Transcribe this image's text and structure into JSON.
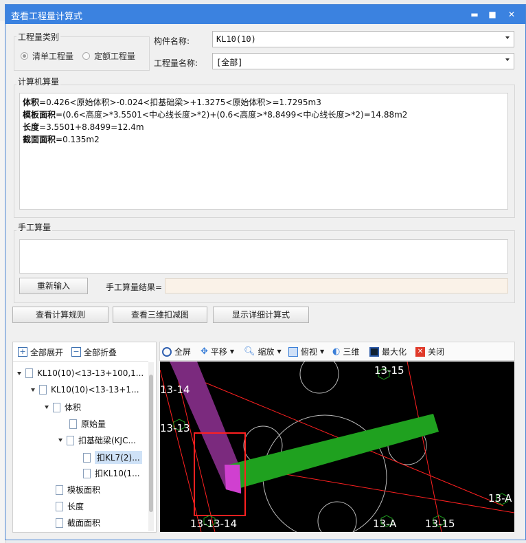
{
  "window": {
    "title": "查看工程量计算式"
  },
  "qty_category": {
    "group_label": "工程量类别",
    "options": [
      {
        "label": "清单工程量",
        "selected": true
      },
      {
        "label": "定额工程量",
        "selected": false
      }
    ]
  },
  "component": {
    "label": "构件名称:",
    "value": "KL10(10)"
  },
  "qty_name": {
    "label": "工程量名称:",
    "value": "[全部]"
  },
  "computer_calc": {
    "group_label": "计算机算量",
    "lines": [
      {
        "key": "体积",
        "expr": "=0.426<原始体积>-0.024<扣基础梁>+1.3275<原始体积>=1.7295m3"
      },
      {
        "key": "模板面积",
        "expr": "=(0.6<高度>*3.5501<中心线长度>*2)+(0.6<高度>*8.8499<中心线长度>*2)=14.88m2"
      },
      {
        "key": "长度",
        "expr": "=3.5501+8.8499=12.4m"
      },
      {
        "key": "截面面积",
        "expr": "=0.135m2"
      }
    ]
  },
  "manual_calc": {
    "group_label": "手工算量",
    "reinput_button": "重新输入",
    "result_label": "手工算量结果="
  },
  "actions": {
    "rules_button": "查看计算规则",
    "deduct3d_button": "查看三维扣减图",
    "detail_button": "显示详细计算式"
  },
  "tree": {
    "expand_all": "全部展开",
    "collapse_all": "全部折叠",
    "items": [
      {
        "label": "KL10(10)<13-13+100,1..."
      },
      {
        "label": "KL10(10)<13-13+1..."
      },
      {
        "label": "体积"
      },
      {
        "label": "原始量"
      },
      {
        "label": "扣基础梁(KJC..."
      },
      {
        "label": "扣KL7(2)..."
      },
      {
        "label": "扣KL10(1..."
      },
      {
        "label": "模板面积"
      },
      {
        "label": "长度"
      },
      {
        "label": "截面面积"
      }
    ]
  },
  "viewer_toolbar": {
    "fullscreen": "全屏",
    "pan": "平移",
    "zoom": "缩放",
    "top_view": "俯视",
    "three_d": "三维",
    "maximize": "最大化",
    "close": "关闭"
  },
  "viewer": {
    "axis_labels": [
      "13-15",
      "13-14",
      "13-13",
      "13-A",
      "13-A",
      "13-15",
      "13‑13‑14"
    ]
  },
  "colors": {
    "titlebar": "#3b82e0",
    "beam_purple": "#7b2a7e",
    "beam_green": "#1fa11f",
    "highlight_red": "#ff2020",
    "magenta": "#d040d0"
  }
}
